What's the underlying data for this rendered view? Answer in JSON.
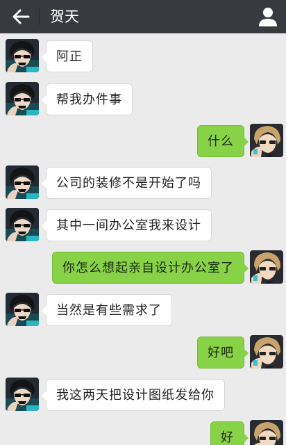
{
  "header": {
    "title": "贺天",
    "back_icon": "back-arrow-icon",
    "profile_icon": "person-icon"
  },
  "colors": {
    "topbar": "#393a3f",
    "background": "#ecebeb",
    "sent_bubble": "#88d247",
    "received_bubble": "#ffffff"
  },
  "messages": [
    {
      "side": "received",
      "text": "阿正"
    },
    {
      "side": "received",
      "text": "帮我办件事"
    },
    {
      "side": "sent",
      "text": "什么"
    },
    {
      "side": "received",
      "text": "公司的装修不是开始了吗"
    },
    {
      "side": "received",
      "text": "其中一间办公室我来设计"
    },
    {
      "side": "sent",
      "text": "你怎么想起亲自设计办公室了"
    },
    {
      "side": "received",
      "text": "当然是有些需求了"
    },
    {
      "side": "sent",
      "text": "好吧"
    },
    {
      "side": "received",
      "text": "我这两天把设计图纸发给你"
    },
    {
      "side": "sent",
      "text": "好"
    }
  ]
}
